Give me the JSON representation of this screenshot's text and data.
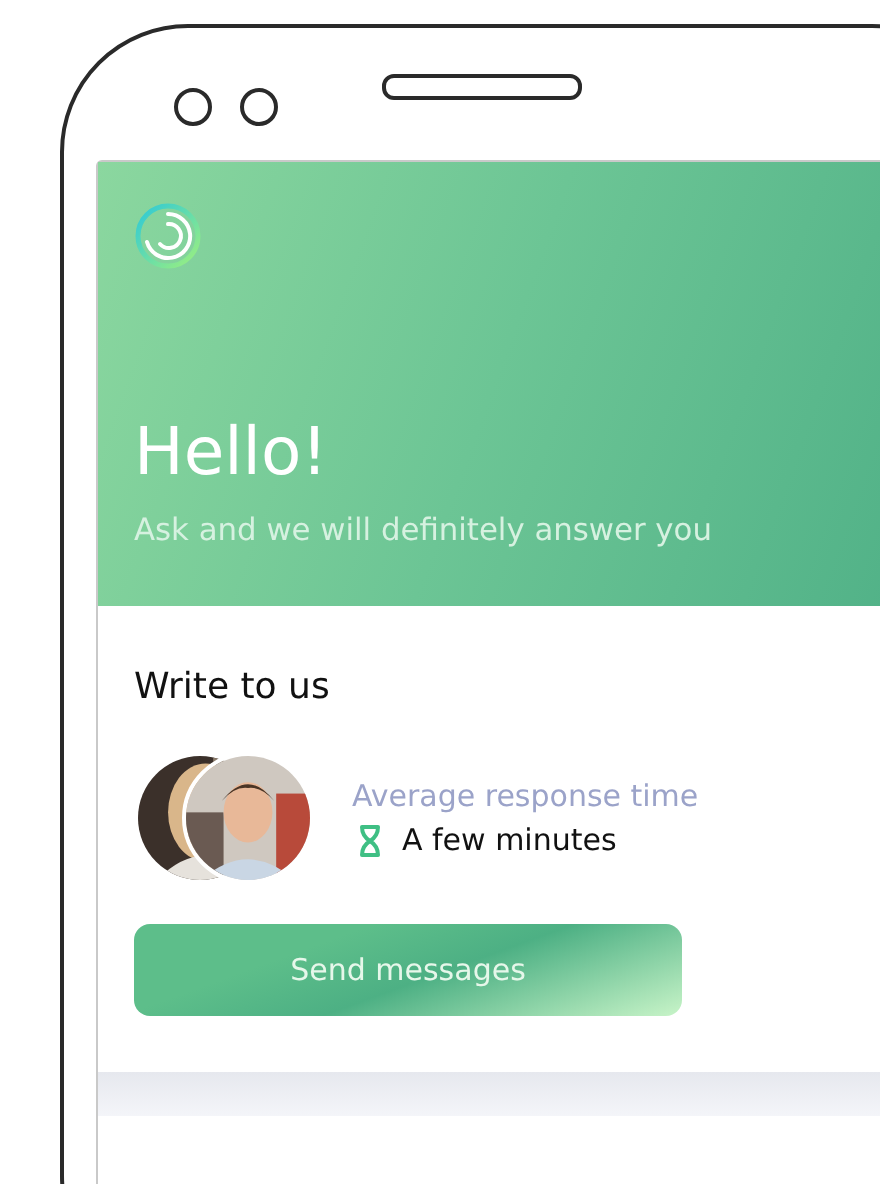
{
  "header": {
    "title": "Hello!",
    "subtitle": "Ask and we will definitely answer you"
  },
  "contact": {
    "title": "Write to us",
    "response_label": "Average response time",
    "response_time": "A few minutes",
    "button": "Send messages"
  }
}
